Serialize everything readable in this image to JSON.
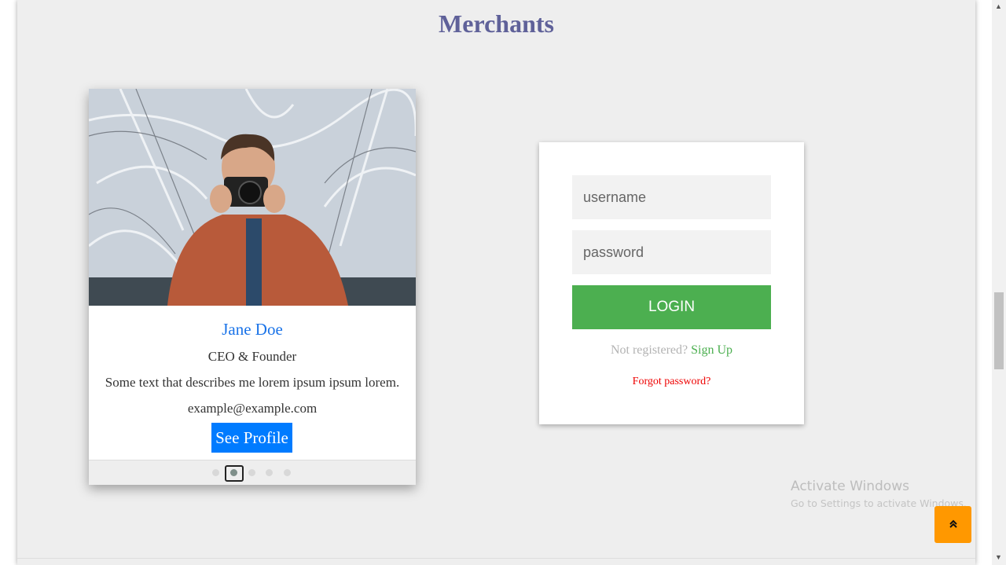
{
  "page": {
    "title": "Merchants"
  },
  "profile_card": {
    "name": "Jane Doe",
    "role": "CEO & Founder",
    "description": "Some text that describes me lorem ipsum ipsum lorem.",
    "email": "example@example.com",
    "button_label": "See Profile",
    "carousel": {
      "total": 5,
      "active_index": 1
    }
  },
  "login": {
    "username_placeholder": "username",
    "password_placeholder": "password",
    "login_label": "LOGIN",
    "not_registered": "Not registered?",
    "signup_label": "Sign Up",
    "forgot_label": "Forgot password?"
  },
  "watermark": {
    "line1": "Activate Windows",
    "line2": "Go to Settings to activate Windows."
  },
  "back_to_top": {
    "icon": "double-chevron-up-icon",
    "glyph": "⌃"
  },
  "colors": {
    "title": "#5f6199",
    "name": "#1a73e8",
    "profile_button": "#007bff",
    "login_button": "#4caf50",
    "signup": "#4caf50",
    "forgot": "#ee0000",
    "back_to_top": "#ff9800"
  }
}
